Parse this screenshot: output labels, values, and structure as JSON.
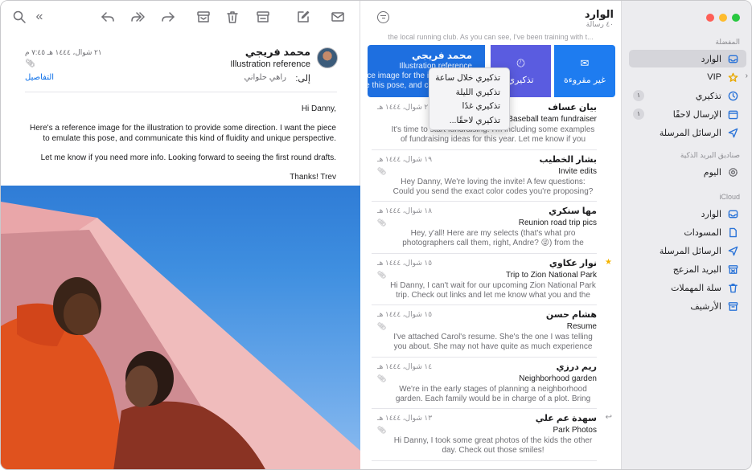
{
  "reader": {
    "toolbar": [
      {
        "name": "search-icon",
        "glyph": "search"
      },
      {
        "name": "expand-icon",
        "glyph": "«"
      },
      {
        "name": "reply-icon",
        "glyph": "reply"
      },
      {
        "name": "reply-all-icon",
        "glyph": "replyall"
      },
      {
        "name": "forward-icon",
        "glyph": "forward"
      },
      {
        "name": "archive-icon",
        "glyph": "archive"
      },
      {
        "name": "trash-icon",
        "glyph": "trash"
      },
      {
        "name": "junk-icon",
        "glyph": "junk"
      },
      {
        "name": "compose-icon",
        "glyph": "compose"
      },
      {
        "name": "get-mail-icon",
        "glyph": "envelope"
      }
    ],
    "sender": "محمد فريجي",
    "subject": "Illustration reference",
    "to_label": "إلى:",
    "to_name": "راهي حلواني",
    "date": "٢١ شوال، ١٤٤٤ هـ ٧:٤٥ م",
    "details": "التفاصيل",
    "body": [
      "Hi Danny,",
      "Here's a reference image for the illustration to provide some direction. I want the piece to emulate this pose, and communicate this kind of fluidity and unique perspective.",
      "Let me know if you need more info. Looking forward to seeing the first round drafts.",
      "Thanks! Trev"
    ]
  },
  "list": {
    "title": "الوارد",
    "count": "٤٠ رسالة",
    "peek": "the local running club. As you can see, I've been training with t...",
    "swipe": {
      "name": "محمد فريجي",
      "subject": "Illustration reference",
      "preview1": "Here's a reference image for the illustration to",
      "preview2": "this piece to emulate this pose, and communicate",
      "remind_label": "تذكيري",
      "unread_label": "غير مقروءة",
      "accent": "#1e6fe0"
    },
    "remind_menu": [
      "تذكيري خلال ساعة",
      "تذكيري الليلة",
      "تذكيري غدًا",
      "تذكيري لاحقًا..."
    ],
    "messages": [
      {
        "name": "بيان عساف",
        "date": "٢٠ شوال، ١٤٤٤ هـ",
        "subject": "Baseball team fundraiser",
        "preview": "It's time to start fundraising. I'm including some examples of fundraising ideas for this year. Let me know if you think...",
        "attach": false,
        "mark": ""
      },
      {
        "name": "بشار الخطيب",
        "date": "١٩ شوال، ١٤٤٤ هـ",
        "subject": "Invite edits",
        "preview": "Hey Danny, We're loving the invite! A few questions: Could you send the exact color codes you're proposing? We'd like to see...",
        "attach": true,
        "mark": ""
      },
      {
        "name": "مها سنكري",
        "date": "١٨ شوال، ١٤٤٤ هـ",
        "subject": "Reunion road trip pics",
        "preview": "Hey, y'all! Here are my selects (that's what pro photographers call them, right, Andre? 😜) from the photos I took over the pa...",
        "attach": true,
        "mark": ""
      },
      {
        "name": "نوار عكاوي",
        "date": "١٥ شوال، ١٤٤٤ هـ",
        "subject": "Trip to Zion National Park",
        "preview": "Hi Danny, I can't wait for our upcoming Zion National Park trip. Check out links and let me know what you and the kids might...",
        "attach": true,
        "mark": "★"
      },
      {
        "name": "هشام حسن",
        "date": "١٥ شوال، ١٤٤٤ هـ",
        "subject": "Resume",
        "preview": "I've attached Carol's resume. She's the one I was telling you about. She may not have quite as much experience as you're lo...",
        "attach": true,
        "mark": ""
      },
      {
        "name": "ريم درزي",
        "date": "١٤ شوال، ١٤٤٤ هـ",
        "subject": "Neighborhood garden",
        "preview": "We're in the early stages of planning a neighborhood garden. Each family would be in charge of a plot. Bring your own wateri...",
        "attach": true,
        "mark": ""
      },
      {
        "name": "سهدة عم علي",
        "date": "١٣ شوال، ١٤٤٤ هـ",
        "subject": "Park Photos",
        "preview": "Hi Danny, I took some great photos of the kids the other day. Check out those smiles!",
        "attach": true,
        "mark": "↩"
      }
    ]
  },
  "sidebar": {
    "favorites_label": "المفضلة",
    "smart_label": "صناديق البريد الذكية",
    "icloud_label": "iCloud",
    "favorites": [
      {
        "label": "الوارد",
        "icon": "tray-icon",
        "badge": "",
        "selected": true
      },
      {
        "label": "VIP",
        "icon": "star-icon",
        "badge": "",
        "selected": false
      },
      {
        "label": "تذكيري",
        "icon": "clock-icon",
        "badge": "١",
        "selected": false
      },
      {
        "label": "الإرسال لاحقًا",
        "icon": "calendar-icon",
        "badge": "١",
        "selected": false
      },
      {
        "label": "الرسائل المرسلة",
        "icon": "paperplane-icon",
        "badge": "",
        "selected": false
      }
    ],
    "smart": [
      {
        "label": "اليوم",
        "icon": "gear-icon"
      }
    ],
    "icloud": [
      {
        "label": "الوارد",
        "icon": "tray-icon"
      },
      {
        "label": "المسودات",
        "icon": "doc-icon"
      },
      {
        "label": "الرسائل المرسلة",
        "icon": "paperplane-icon"
      },
      {
        "label": "البريد المزعج",
        "icon": "junk-icon"
      },
      {
        "label": "سلة المهملات",
        "icon": "trash-icon"
      },
      {
        "label": "الأرشيف",
        "icon": "archive-icon"
      }
    ]
  }
}
